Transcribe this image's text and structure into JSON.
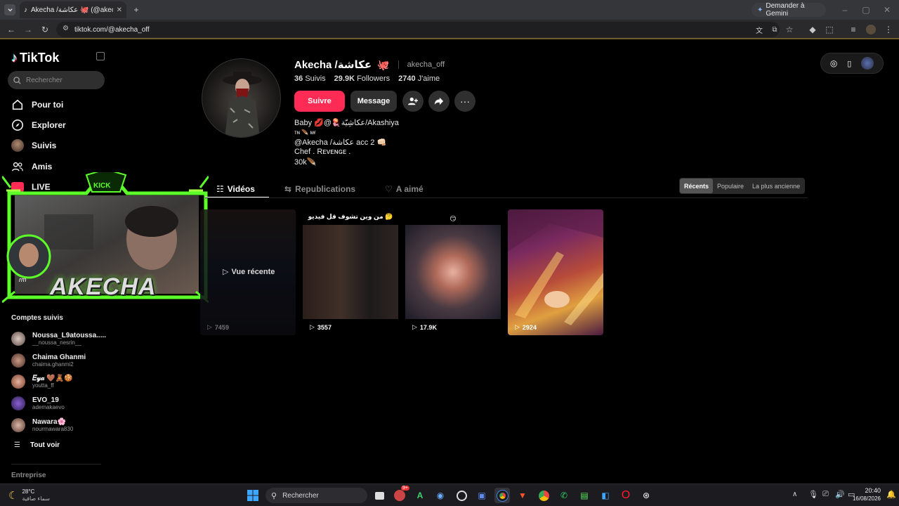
{
  "browser": {
    "tab_title": "Akecha /عكاشة 🐙 (@akecha_o",
    "url": "tiktok.com/@akecha_off",
    "gemini_label": "Demander à Gemini"
  },
  "sidebar": {
    "logo": "TikTok",
    "search_placeholder": "Rechercher",
    "nav": [
      {
        "label": "Pour toi"
      },
      {
        "label": "Explorer"
      },
      {
        "label": "Suivis"
      },
      {
        "label": "Amis"
      },
      {
        "label": "LIVE"
      }
    ],
    "following_title": "Comptes suivis",
    "following": [
      {
        "name": "Noussa_L9atoussa.....",
        "user": "__noussa_nesrin__"
      },
      {
        "name": "Chaima Ghanmi",
        "user": "chaima.ghanmi2"
      },
      {
        "name": "𝐸𝓎𝒶 🤎🧸🍪",
        "user": "youtta_ff"
      },
      {
        "name": "EVO_19",
        "user": "ademakaevo"
      },
      {
        "name": "Nawara🌸",
        "user": "nourrnawara830"
      }
    ],
    "see_all": "Tout voir",
    "footer": "Entreprise"
  },
  "profile": {
    "display_name": "Akecha /عكاشة",
    "username": "akecha_off",
    "stats": {
      "following_count": "36",
      "following_label": "Suivis",
      "followers_count": "29.9K",
      "followers_label": "Followers",
      "likes_count": "2740",
      "likes_label": "J'aime"
    },
    "follow_btn": "Suivre",
    "message_btn": "Message",
    "bio_lines": [
      "Baby 💋@🪼عكاشِيّة/Akashiya",
      "ᴛɴ 🪶 ᴍғ",
      "@Akecha /عكاشة acc 2 👊🏻",
      "Chef .   Rᴇᴠᴇɴɢᴇ   .",
      "30k🪶"
    ]
  },
  "content_tabs": [
    "Vidéos",
    "Republications",
    "A aimé"
  ],
  "sort_options": [
    "Récents",
    "Populaire",
    "La plus ancienne"
  ],
  "videos": [
    {
      "views": "7459",
      "badge": "Vue récente",
      "caption": ""
    },
    {
      "views": "3557",
      "caption": "من وين تشوف قل فيديو 🤔"
    },
    {
      "views": "17.9K",
      "caption": "😏"
    },
    {
      "views": "2924",
      "caption": ""
    }
  ],
  "overlay": {
    "name": "AKECHA",
    "kick": "KICK",
    "tag": "rm"
  },
  "taskbar": {
    "temp": "28°C",
    "weather": "سماء صافية",
    "search_label": "Rechercher",
    "time": "20:40",
    "date": "16/08/2026",
    "badge": "9+"
  }
}
